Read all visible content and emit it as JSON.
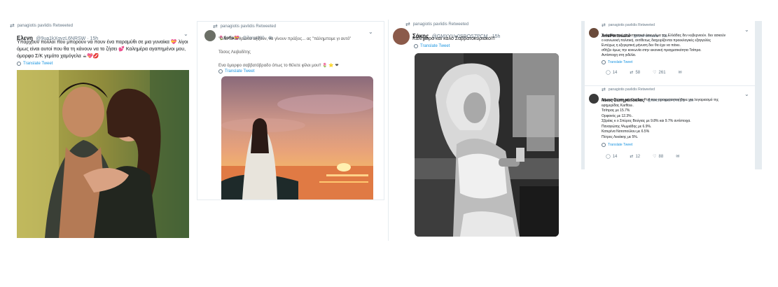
{
  "tweet1": {
    "retweeted_by": "panagiotis pavlidis Retweeted",
    "name": "Ελενη",
    "handle": "@9ua1kXgvzL6NRSW · 15h",
    "text_lines": [
      "Υπάρχουν πολλοί που μπορούν να πουν ένα παραμύθι σε μια γυναίκα 💝 λίγοι",
      "όμως είναι αυτοί που θα τη κάνουν να το ζήσει 💕 Καλημέρα αγαπημένοι μου,",
      "όμορφο Σ/Κ γεμάτο χαμόγελα ☕💖💋"
    ],
    "translate": "Translate Tweet"
  },
  "tweet2": {
    "retweeted_by": "panagiotis pavlidis Retweeted",
    "name": "🌷Sofia💝",
    "handle": "@Zorca800 · 4h",
    "text_lines": [
      "\"Όλα τα άνθρωπα αξίζουν, να γίνουν πράξεις... ας \"πάλημπομε γι αυτό\""
    ],
    "author_line": "Τάσος Λειβαδίτης",
    "wish_line": "Ενα όμορφο σαββατόβραδο όπως το θέλετε φίλοι μου!! 🌷 ⭐ ❤",
    "translate": "Translate Tweet"
  },
  "tweet3": {
    "retweeted_by": "panagiotis pavlidis Retweeted",
    "name": "Σάκης",
    "handle": "@GMXYUx0SDOSZPCM · 15h",
    "text": "Καλημέρα και καλό Σαββατοκυριακο!!!",
    "translate": "Translate Tweet"
  },
  "tweet4": {
    "retweeted_by": "panagiotis pavlidis Retweeted",
    "name": "ArisPortosalte",
    "handle": "@ArisPortosalte · 11h",
    "text_lines": [
      "Σκεφτείτε πού το δισταστικό άσκγυλμα της Ελλάδας δεν κυβερνιούν. δεν ασκούν",
      "ο κοινωνική πολιτική, αντίθετως διαχειρίζονται προεκλογικές εξαγγελίες",
      "Εντύχως η εξεγερτική μήνυση δεν θα έχει να πάνει.",
      "σθήζει όμως την κοινωνία στην εικονική πραγματικότητα Τσίπρα.",
      "Αντίστοιχη στη γιδιλία."
    ],
    "translate": "Translate Tweet",
    "replies": "14",
    "retweets": "58",
    "likes": "261"
  },
  "tweet5": {
    "retweeted_by": "panagiotis pavlidis Retweeted",
    "name": "Νίκος Σωτηρόπουλος",
    "handle": "@NIKSOTIROPOYLOS · 11h",
    "text_lines": [
      "Δημοσκόπηση της Opinion Poll που πραγματοποιήθηκε για λογαριασμό της",
      "εφημερίδας Karfitsa .",
      "Τσίπρας με 15.7%",
      "Ορφανός με 12.3% .",
      "Σβράκς κ ο Σπύρος Βούγιας με 9.8% και 9.7% αντίστοιχα.",
      " Παναγιώτης Ψωμιάδης με 6.9%.",
      "Κατερίνα Νοτοπούλου με 6.5%",
      "Πέτρος Λεκάκης με 5%."
    ],
    "translate": "Translate Tweet",
    "replies": "14",
    "retweets": "12",
    "likes": "88"
  },
  "icons": {
    "retweet": "retweet-icon",
    "chevron": "chevron-down-icon",
    "reply": "reply-icon",
    "like": "heart-icon",
    "message": "message-icon"
  }
}
